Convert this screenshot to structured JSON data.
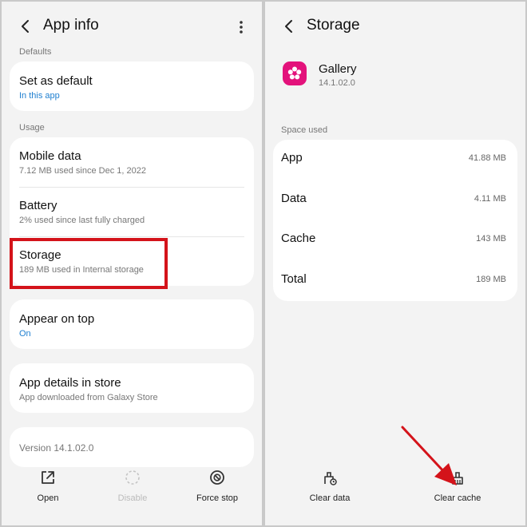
{
  "left": {
    "header": {
      "title": "App info"
    },
    "sections": {
      "defaults_label": "Defaults",
      "usage_label": "Usage"
    },
    "set_default": {
      "title": "Set as default",
      "subtitle": "In this app"
    },
    "mobile_data": {
      "title": "Mobile data",
      "subtitle": "7.12 MB used since Dec 1, 2022"
    },
    "battery": {
      "title": "Battery",
      "subtitle": "2% used since last fully charged"
    },
    "storage": {
      "title": "Storage",
      "subtitle": "189 MB used in Internal storage"
    },
    "appear_on_top": {
      "title": "Appear on top",
      "subtitle": "On"
    },
    "app_details": {
      "title": "App details in store",
      "subtitle": "App downloaded from Galaxy Store"
    },
    "version": "Version 14.1.02.0",
    "bottom_bar": {
      "open": "Open",
      "disable": "Disable",
      "force_stop": "Force stop"
    }
  },
  "right": {
    "header": {
      "title": "Storage"
    },
    "app": {
      "name": "Gallery",
      "version": "14.1.02.0",
      "icon": "gallery-flower-icon",
      "icon_color": "#e3127b"
    },
    "space_used_label": "Space used",
    "storage_rows": [
      {
        "label": "App",
        "value": "41.88 MB"
      },
      {
        "label": "Data",
        "value": "4.11 MB"
      },
      {
        "label": "Cache",
        "value": "143 MB"
      },
      {
        "label": "Total",
        "value": "189 MB"
      }
    ],
    "bottom_bar": {
      "clear_data": "Clear data",
      "clear_cache": "Clear cache"
    }
  },
  "colors": {
    "accent_blue": "#1e7fd0",
    "highlight_red": "#d4131a",
    "arrow_red": "#d4131a"
  }
}
